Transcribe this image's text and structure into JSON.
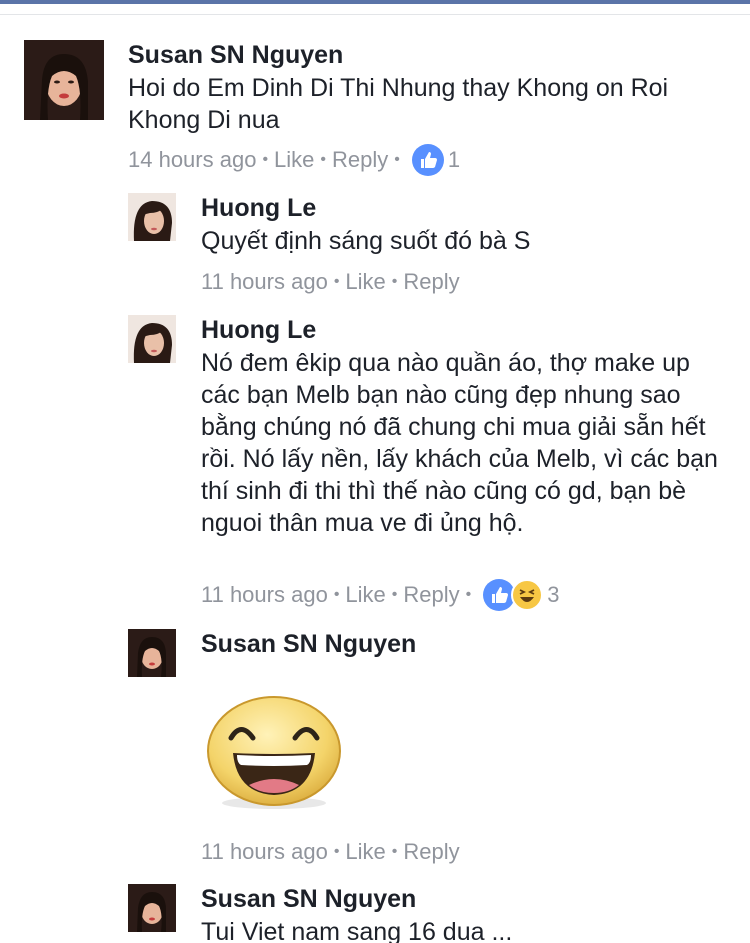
{
  "comments": [
    {
      "name": "Susan SN Nguyen",
      "text": "Hoi do Em Dinh Di Thi Nhung thay Khong on Roi Khong Di nua",
      "time": "14 hours ago",
      "like_label": "Like",
      "reply_label": "Reply",
      "reaction_count": "1",
      "reactions": [
        "like-icon"
      ]
    },
    {
      "name": "Huong Le",
      "text": "Quyết định sáng suốt đó bà S",
      "time": "11 hours ago",
      "like_label": "Like",
      "reply_label": "Reply"
    },
    {
      "name": "Huong Le",
      "text": "Nó đem êkip qua nào quần áo, thợ make up các bạn Melb bạn nào cũng đẹp nhung sao bằng chúng nó đã chung chi mua giải sẵn hết rồi. Nó lấy nền, lấy khách của Melb, vì các bạn thí sinh đi thi thì thế nào cũng có gd, bạn bè nguoi thân mua ve đi ủng hộ.",
      "time": "11 hours ago",
      "like_label": "Like",
      "reply_label": "Reply",
      "reaction_count": "3",
      "reactions": [
        "like-icon",
        "haha-icon"
      ]
    },
    {
      "name": "Susan SN Nguyen",
      "sticker": "laughing-face-sticker",
      "time": "11 hours ago",
      "like_label": "Like",
      "reply_label": "Reply"
    },
    {
      "name": "Susan SN Nguyen",
      "text": "Tui Viet nam sang 16 dua ..."
    }
  ],
  "colors": {
    "name": "#1d2129",
    "meta": "#90949c",
    "like_blue": "#5890ff",
    "haha_yellow": "#f7c744"
  }
}
